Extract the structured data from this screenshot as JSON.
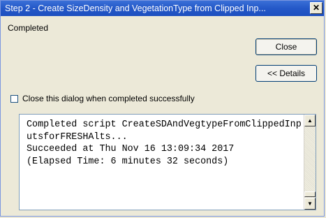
{
  "window": {
    "title": "Step 2 - Create SizeDensity and VegetationType from Clipped Inp...",
    "close_glyph": "✕"
  },
  "status_text": "Completed",
  "buttons": {
    "close_label": "Close",
    "details_label": "<< Details"
  },
  "checkbox": {
    "label": "Close this dialog when completed successfully",
    "checked": false
  },
  "messages": {
    "text": "Completed script CreateSDAndVegtypeFromClippedInputsforFRESHAlts...\nSucceeded at Thu Nov 16 13:09:34 2017\n(Elapsed Time: 6 minutes 32 seconds)"
  },
  "scrollbar": {
    "up_glyph": "▲",
    "down_glyph": "▼"
  }
}
